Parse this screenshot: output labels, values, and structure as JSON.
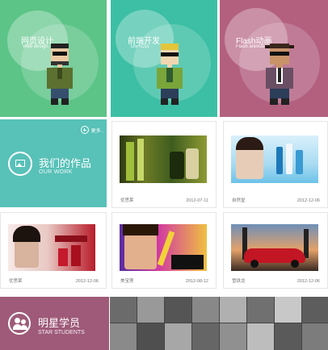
{
  "tiles": [
    {
      "cn": "网页设计",
      "en": "Web design",
      "bg": "#5cc487"
    },
    {
      "cn": "前端开发",
      "en": "Div+Css",
      "bg": "#3cbfa4"
    },
    {
      "cn": "Flash动画",
      "en": "Flash animation",
      "bg": "#b3607f"
    }
  ],
  "works": {
    "title": "我们的作品",
    "subtitle": "OUR WORK",
    "more": "更多..",
    "bg": "#58c1b8"
  },
  "cards": [
    {
      "name": "优思莱",
      "date": "2012-07-11"
    },
    {
      "name": "自然堂",
      "date": "2012-12-06"
    },
    {
      "name": "优思莱",
      "date": "2012-12-06"
    },
    {
      "name": "美宝莲",
      "date": "2012-08-12"
    },
    {
      "name": "雪铁龙",
      "date": "2012-12-06"
    }
  ],
  "students": {
    "title": "明星学员",
    "subtitle": "STAR STUDENTS",
    "bg": "#9e5a78"
  },
  "icons": {
    "more": "plus-circle-icon",
    "works": "picture-icon",
    "students": "users-icon"
  }
}
